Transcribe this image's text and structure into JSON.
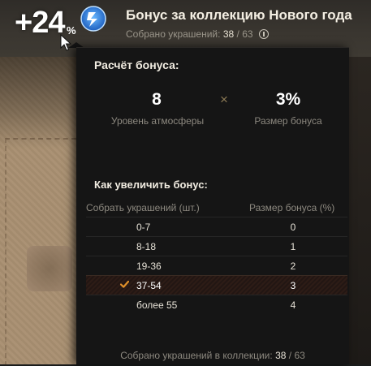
{
  "header": {
    "bonus_value": "+24",
    "bonus_sign": "%",
    "title": "Бонус за коллекцию Нового года",
    "collected_label": "Собрано украшений:",
    "collected_current": "38",
    "collected_sep": " / ",
    "collected_total": "63",
    "icon": "atmosphere-icon"
  },
  "calc": {
    "title": "Расчёт бонуса:",
    "atmosphere_level": "8",
    "atmosphere_label": "Уровень атмосферы",
    "multiply_sign": "×",
    "bonus_size": "3%",
    "bonus_size_label": "Размер бонуса"
  },
  "increase": {
    "title": "Как увеличить бонус:",
    "col_collect": "Собрать украшений (шт.)",
    "col_bonus": "Размер бонуса (%)",
    "rows": [
      {
        "range": "0-7",
        "bonus": "0"
      },
      {
        "range": "8-18",
        "bonus": "1"
      },
      {
        "range": "19-36",
        "bonus": "2"
      },
      {
        "range": "37-54",
        "bonus": "3"
      },
      {
        "range": "более 55",
        "bonus": "4"
      }
    ],
    "active_row": 3
  },
  "footer": {
    "label": "Собрано украшений в коллекции:",
    "current": "38",
    "sep": " / ",
    "total": "63"
  },
  "colors": {
    "accent_check": "#e0902a",
    "panel_bg": "#151515"
  }
}
